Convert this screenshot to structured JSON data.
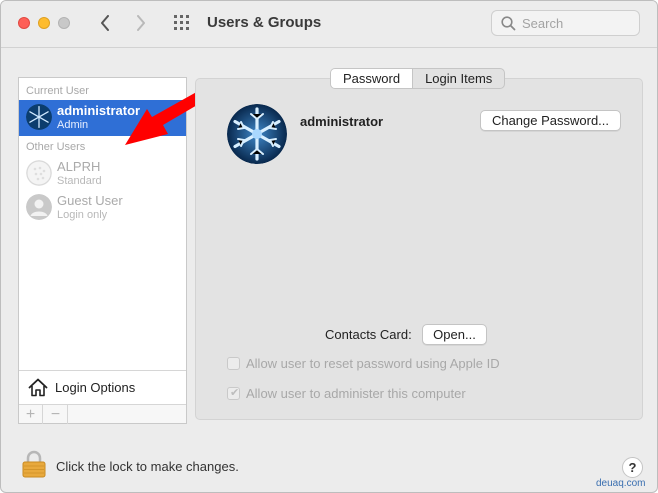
{
  "window": {
    "title": "Users & Groups"
  },
  "search": {
    "placeholder": "Search",
    "value": ""
  },
  "sidebar": {
    "current_user_label": "Current User",
    "other_users_label": "Other Users",
    "users": [
      {
        "name": "administrator",
        "role": "Admin",
        "selected": true
      },
      {
        "name": "ALPRH",
        "role": "Standard",
        "selected": false
      },
      {
        "name": "Guest User",
        "role": "Login only",
        "selected": false
      }
    ],
    "login_options_label": "Login Options",
    "plus_label": "+",
    "minus_label": "−"
  },
  "main": {
    "tabs": [
      {
        "label": "Password",
        "active": true
      },
      {
        "label": "Login Items",
        "active": false
      }
    ],
    "username": "administrator",
    "change_password_label": "Change Password...",
    "contacts_card_label": "Contacts Card:",
    "open_label": "Open...",
    "checkboxes": [
      {
        "label": "Allow user to reset password using Apple ID",
        "checked": false
      },
      {
        "label": "Allow user to administer this computer",
        "checked": true
      }
    ]
  },
  "footer": {
    "lock_text": "Click the lock to make changes.",
    "help_label": "?"
  },
  "watermark": "deuaq.com",
  "colors": {
    "selection": "#2f6fd6",
    "annotation_arrow": "#ff0000"
  }
}
